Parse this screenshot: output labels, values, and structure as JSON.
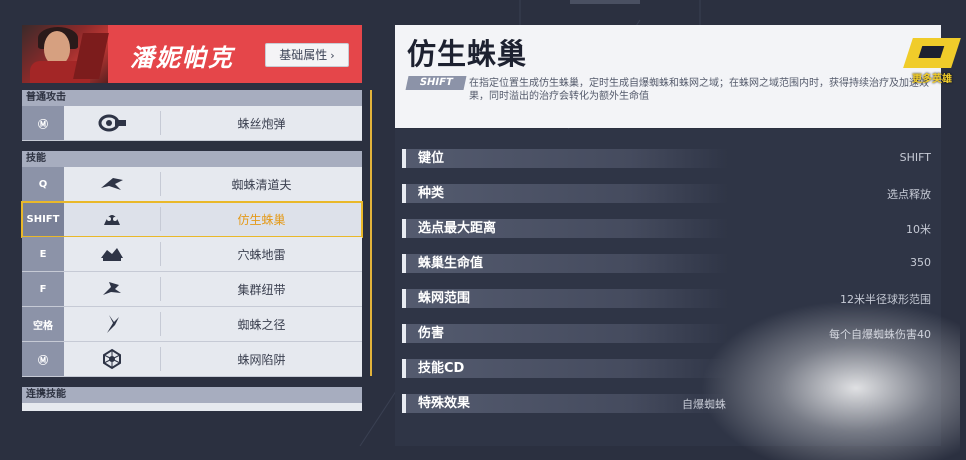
{
  "hero": {
    "name": "潘妮帕克",
    "attr_button": "基础属性"
  },
  "left": {
    "sections": [
      {
        "title": "普通攻击",
        "rows": [
          {
            "key": "Ⓜ",
            "icon": "web-cannon-icon",
            "name": "蛛丝炮弹"
          }
        ]
      },
      {
        "title": "技能",
        "rows": [
          {
            "key": "Q",
            "icon": "spider-sweeper-icon",
            "name": "蜘蛛清道夫"
          },
          {
            "key": "SHIFT",
            "icon": "spider-nest-icon",
            "name": "仿生蛛巢",
            "selected": true
          },
          {
            "key": "E",
            "icon": "burrow-mine-icon",
            "name": "穴蛛地雷"
          },
          {
            "key": "F",
            "icon": "swarm-tether-icon",
            "name": "集群纽带"
          },
          {
            "key": "空格",
            "icon": "spider-path-icon",
            "name": "蜘蛛之径"
          },
          {
            "key": "Ⓜ",
            "icon": "web-trap-icon",
            "name": "蛛网陷阱"
          }
        ]
      },
      {
        "title": "连携技能",
        "rows": []
      }
    ]
  },
  "skill": {
    "title": "仿生蛛巢",
    "key_tag": "SHIFT",
    "description": "在指定位置生成仿生蛛巢，定时生成自爆蜘蛛和蛛网之域；在蛛网之域范围内时，获得持续治疗及加速效果，同时溢出的治疗会转化为额外生命值",
    "badge_text": "更多英雄",
    "stats": [
      {
        "label": "键位",
        "value": "SHIFT"
      },
      {
        "label": "种类",
        "value": "选点释放"
      },
      {
        "label": "选点最大距离",
        "value": "10米"
      },
      {
        "label": "蛛巢生命值",
        "value": "350"
      },
      {
        "label": "蛛网范围",
        "value": "12米半径球形范围"
      },
      {
        "label": "伤害",
        "value": "每个自爆蜘蛛伤害40"
      },
      {
        "label": "技能CD",
        "value": ""
      },
      {
        "label": "特殊效果",
        "value": "自爆蜘蛛"
      }
    ]
  },
  "colors": {
    "accent": "#e5464a",
    "highlight": "#e9b82a",
    "background": "#2b3040"
  }
}
